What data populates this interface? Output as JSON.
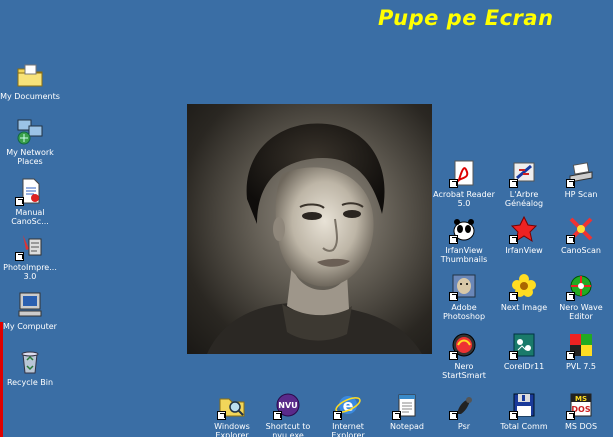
{
  "title": "Pupe pe Ecran",
  "colors": {
    "desktop": "#3a6ea5",
    "title": "#ffff00",
    "label": "#ffffff"
  },
  "left_icons": [
    {
      "label": "My Documents",
      "icon": "folder-icon"
    },
    {
      "label": "My Network Places",
      "icon": "network-icon"
    },
    {
      "label": "Manual CanoSc...",
      "icon": "document-icon"
    },
    {
      "label": "PhotoImpre... 3.0",
      "icon": "photoimpression-icon"
    },
    {
      "label": "My Computer",
      "icon": "computer-icon"
    },
    {
      "label": "Recycle Bin",
      "icon": "recycle-bin-icon"
    }
  ],
  "right_icons": [
    {
      "label": "Acrobat Reader 5.0",
      "icon": "acrobat-icon"
    },
    {
      "label": "L'Arbre Généalog",
      "icon": "tree-icon"
    },
    {
      "label": "HP Scan",
      "icon": "scanner-icon"
    },
    {
      "label": "IrfanView Thumbnails",
      "icon": "irfanview-thumbnails-icon"
    },
    {
      "label": "IrfanView",
      "icon": "irfanview-icon"
    },
    {
      "label": "CanoScan",
      "icon": "canoscan-icon"
    },
    {
      "label": "Adobe Photoshop",
      "icon": "photoshop-icon"
    },
    {
      "label": "Next Image",
      "icon": "flower-icon"
    },
    {
      "label": "Nero Wave Editor",
      "icon": "nero-wave-icon"
    },
    {
      "label": "Nero StartSmart",
      "icon": "nero-icon"
    },
    {
      "label": "CorelDr11",
      "icon": "corel-icon"
    },
    {
      "label": "PVL 7.5",
      "icon": "pvl-icon"
    }
  ],
  "bottom_icons": [
    {
      "label": "Windows Explorer",
      "icon": "explorer-icon"
    },
    {
      "label": "Shortcut to nvu.exe",
      "icon": "nvu-icon"
    },
    {
      "label": "Internet Explorer",
      "icon": "internet-explorer-icon"
    },
    {
      "label": "Notepad",
      "icon": "notepad-icon"
    },
    {
      "label": "Psr",
      "icon": "psr-icon"
    },
    {
      "label": "Total Comm",
      "icon": "floppy-icon"
    },
    {
      "label": "MS DOS",
      "icon": "msdos-icon"
    }
  ],
  "photo": {
    "subject": "portrait-photo"
  }
}
